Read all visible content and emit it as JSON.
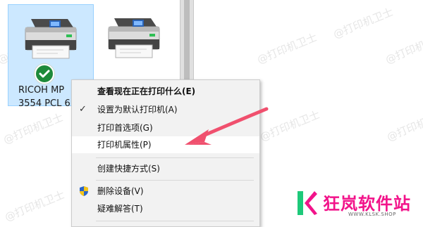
{
  "watermark": "@打印机卫士",
  "devices": [
    {
      "name": "RICOH MP\n3554 PCL 6",
      "selected": true,
      "default": true
    },
    {
      "name": "",
      "selected": false,
      "default": false
    }
  ],
  "context_menu": {
    "items": [
      {
        "label": "查看现在正在打印什么(E)"
      },
      {
        "label": "设置为默认打印机(A)"
      },
      {
        "label": "打印首选项(G)"
      },
      {
        "label": "打印机属性(P)"
      },
      {
        "label": "创建快捷方式(S)"
      },
      {
        "label": "删除设备(V)"
      },
      {
        "label": "疑难解答(T)"
      }
    ]
  },
  "logo": {
    "title": "狂岚软件站",
    "subtitle": "WWW.KLSK.SHOP"
  },
  "colors": {
    "selection": "#cce8ff",
    "arrow": "#f0506e",
    "logo_pink": "#f2138a",
    "logo_green": "#1ec97a"
  }
}
